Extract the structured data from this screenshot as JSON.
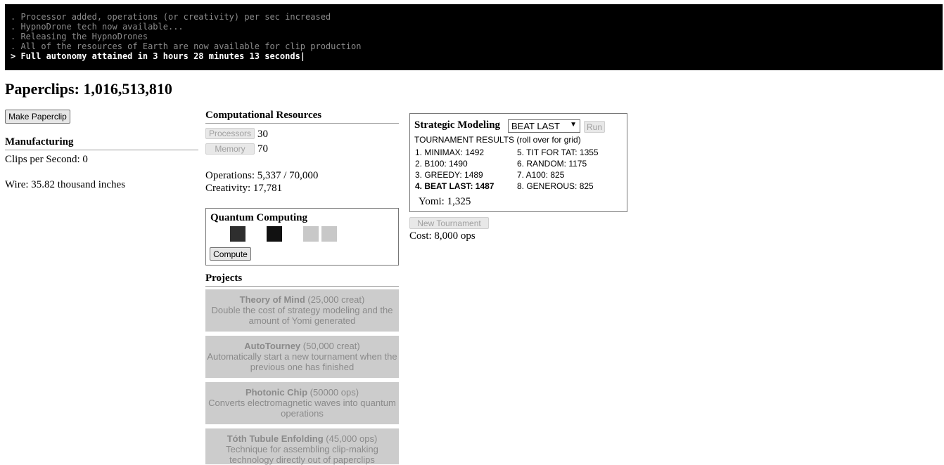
{
  "console": {
    "lines": [
      ". Processor added, operations (or creativity) per sec increased",
      ". HypnoDrone tech now available...",
      ". Releasing the HypnoDrones",
      ". All of the resources of Earth are now available for clip production"
    ],
    "last": "> Full autonomy attained in 3 hours 28 minutes 13 seconds|"
  },
  "clips": {
    "label": "Paperclips: 1,016,513,810"
  },
  "manufacturing": {
    "make_button": "Make Paperclip",
    "heading": "Manufacturing",
    "clips_per_second": "Clips per Second: 0",
    "wire": "Wire: 35.82 thousand inches"
  },
  "computational": {
    "heading": "Computational Resources",
    "processors_label": "Processors",
    "processors_value": "30",
    "memory_label": "Memory",
    "memory_value": "70",
    "operations_prefix": "Operations: ",
    "operations_value": "5,337",
    "operations_sep": " / ",
    "operations_max": "70,000",
    "creativity_prefix": "Creativity: ",
    "creativity_value": "17,781"
  },
  "quantum": {
    "heading": "Quantum Computing",
    "compute_button": "Compute",
    "chip_colors": [
      "#2e2e2e",
      "#111111",
      "#c8c8c8",
      "#c8c8c8"
    ]
  },
  "projects": {
    "heading": "Projects",
    "items": [
      {
        "name": "Theory of Mind",
        "cost": "(25,000 creat)",
        "desc": "Double the cost of strategy modeling and the amount of Yomi generated"
      },
      {
        "name": "AutoTourney",
        "cost": "(50,000 creat)",
        "desc": "Automatically start a new tournament when the previous one has finished"
      },
      {
        "name": "Photonic Chip",
        "cost": "(50000 ops)",
        "desc": "Converts electromagnetic waves into quantum operations"
      },
      {
        "name": "Tóth Tubule Enfolding",
        "cost": "(45,000 ops)",
        "desc": "Technique for assembling clip-making technology directly out of paperclips"
      }
    ]
  },
  "strategy": {
    "heading": "Strategic Modeling",
    "selected": "BEAT LAST",
    "run_button": "Run",
    "tournament_label": "TOURNAMENT RESULTS (roll over for grid)",
    "results": [
      "1. MINIMAX: 1492",
      "2. B100: 1490",
      "3. GREEDY: 1489",
      "4. BEAT LAST: 1487",
      "5. TIT FOR TAT: 1355",
      "6. RANDOM: 1175",
      "7. A100: 825",
      "8. GENEROUS: 825"
    ],
    "yomi": "Yomi: 1,325",
    "new_tournament_button": "New Tournament",
    "cost": "Cost: 8,000 ops"
  },
  "colors": {
    "console_bg": "#000000",
    "console_text": "#8c8c8c",
    "project_bg": "#cccccc",
    "project_text": "#8a8a8a"
  }
}
